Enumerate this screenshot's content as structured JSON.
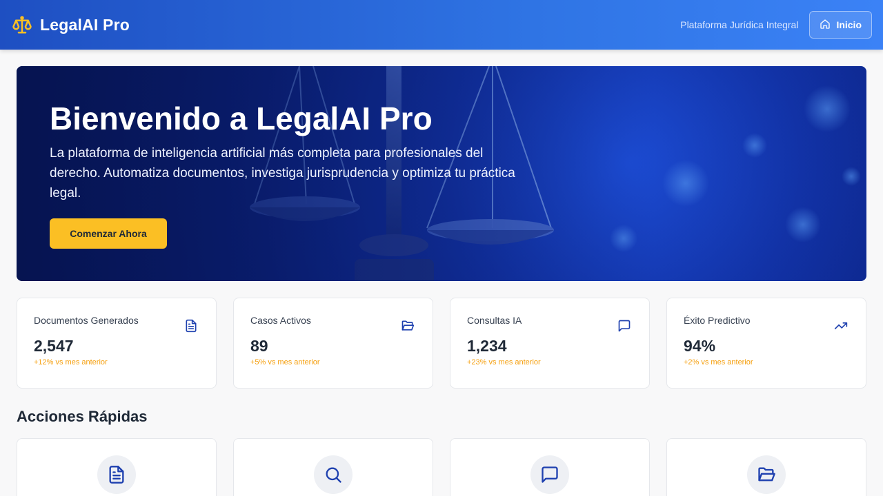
{
  "header": {
    "app_name": "LegalAI Pro",
    "tagline": "Plataforma Jurídica Integral",
    "home_label": "Inicio",
    "brand_icon": "scale-icon",
    "home_icon": "home-icon"
  },
  "hero": {
    "title": "Bienvenido a LegalAI Pro",
    "text": "La plataforma de inteligencia artificial más completa para profesionales del derecho. Automatiza documentos, investiga jurisprudencia y optimiza tu práctica legal.",
    "cta_label": "Comenzar Ahora"
  },
  "stats": [
    {
      "label": "Documentos Generados",
      "value": "2,547",
      "delta": "+12% vs mes anterior",
      "icon": "document-icon"
    },
    {
      "label": "Casos Activos",
      "value": "89",
      "delta": "+5% vs mes anterior",
      "icon": "folder-open-icon"
    },
    {
      "label": "Consultas IA",
      "value": "1,234",
      "delta": "+23% vs mes anterior",
      "icon": "chat-icon"
    },
    {
      "label": "Éxito Predictivo",
      "value": "94%",
      "delta": "+2% vs mes anterior",
      "icon": "trending-up-icon"
    }
  ],
  "quick_actions": {
    "title": "Acciones Rápidas",
    "items": [
      {
        "icon": "document-icon"
      },
      {
        "icon": "search-icon"
      },
      {
        "icon": "chat-icon"
      },
      {
        "icon": "folder-open-icon"
      }
    ]
  },
  "colors": {
    "primary": "#1e40af",
    "accent": "#fbbf24",
    "delta": "#f59e0b",
    "header_start": "#1e4fc2",
    "header_end": "#3b82f6"
  }
}
